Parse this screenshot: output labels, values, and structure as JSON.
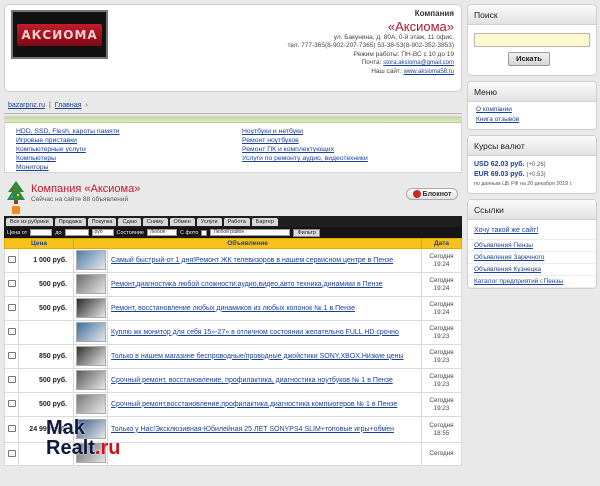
{
  "header": {
    "logo_text": "АКСИОМА",
    "company_label": "Компания",
    "company_name": "«Аксиома»",
    "address": "ул. Бакунина, д. 80А, 0-й этаж, 11 офис.",
    "phone": "тел. 777-365(8-902-207-7365) 53-38-53(8-902-352-3853)",
    "hours": "Режим работы: ПН-ВС с 10 до 19",
    "email_label": "Почта:",
    "email": "stora.aksioma@gmail.com",
    "site_label": "Наш сайт:",
    "site": "www.aksioma58.ru"
  },
  "breadcrumb": {
    "site": "bazarpnz.ru",
    "sep": "|",
    "home": "Главная",
    "arrow": "›"
  },
  "categories": {
    "left": [
      "HDD, SSD, Flesh, кароты памяти",
      "Игровые приставки",
      "Компьютерные услуги",
      "Компьютеры",
      "Мониторы"
    ],
    "right": [
      "Ноутбуки и нетбуки",
      "Ремонт ноутбуков",
      "Ремонт ПК и комплектующих",
      "Услуги по ремонту аудио, видеотехники"
    ]
  },
  "banner": {
    "title": "Компания «Аксиома»",
    "subtitle": "Сейчас на сайте 88 объявлений",
    "notebook_button": "Блокнот"
  },
  "tabs": [
    "Все из рубрики",
    "Продажа",
    "Покупка",
    "Сдаю",
    "Сниму",
    "Обмен",
    "Услуги",
    "Работа",
    "Бартер"
  ],
  "filters": {
    "price_from": "Цена от",
    "price_to": "до",
    "currency": "руб",
    "condition_label": "Состояние",
    "condition_value": "Любое",
    "photo_label": "С фото",
    "district_value": "Любой район",
    "filter_button": "Фильтр"
  },
  "table": {
    "columns": [
      "Цена",
      "Объявление",
      "Дата"
    ],
    "rows": [
      {
        "price": "1 000 руб.",
        "title": "Самый быстрый-от 1 дня!Ремонт ЖК телевизоров в нашем сервисном центре в Пензе",
        "date": "Сегодня",
        "time": "19:24",
        "thumb_color": "#4f7db0"
      },
      {
        "price": "500 руб.",
        "title": "Ремонт,диагностика любой сложности:аудио,видео,авто техника,динамики в Пензе",
        "date": "Сегодня",
        "time": "19:24",
        "thumb_color": "#6b6b6b"
      },
      {
        "price": "500 руб.",
        "title": "Ремонт, восстановление любых динамиков из любых колонок № 1 в Пензе",
        "date": "Сегодня",
        "time": "19:24",
        "thumb_color": "#2a2a2a"
      },
      {
        "price": "",
        "title": "Куплю жк монитор для себя 15»-27» в отличном состоянии желательно FULL HD срочно",
        "date": "Сегодня",
        "time": "19:23",
        "thumb_color": "#3b6f9e"
      },
      {
        "price": "850 руб.",
        "title": "Только в нашем магазине беспроводные/проводные джойстики SONY,XBOX.Низкие цены",
        "date": "Сегодня",
        "time": "19:23",
        "thumb_color": "#333333"
      },
      {
        "price": "500 руб.",
        "title": "Срочный ремонт, восстановление, профилактика, диагностика ноутбуков № 1 в Пензе",
        "date": "Сегодня",
        "time": "19:23",
        "thumb_color": "#5a5a5a"
      },
      {
        "price": "500 руб.",
        "title": "Срочный ремонт,восстановление,профилактика,диагностика компьютеров № 1 в Пензе",
        "date": "Сегодня",
        "time": "19:23",
        "thumb_color": "#7a7a7a"
      },
      {
        "price": "24 999 руб.",
        "title": "Только у Нас!Эксклюзивная-Юбилейная 25 ЛЕТ SONYPS4 SLIM+топовые игры+обмен",
        "date": "Сегодня",
        "time": "18:55",
        "thumb_color": "#3a5e8c"
      },
      {
        "price": "",
        "title": "",
        "date": "Сегодня",
        "time": "",
        "thumb_color": "#666666"
      }
    ]
  },
  "sidebar": {
    "search_title": "Поиск",
    "search_button": "Искать",
    "menu_title": "Меню",
    "menu_items": [
      "О компании",
      "Книга отзывов"
    ],
    "currency_title": "Курсы валют",
    "currencies": [
      {
        "code": "USD",
        "value": "62.03 руб.",
        "change": "(+0.26)"
      },
      {
        "code": "EUR",
        "value": "69.03 руб.",
        "change": "(+0.53)"
      }
    ],
    "currency_note": "по данным ЦБ РФ на 20 декабря 2019 г.",
    "links_title": "Ссылки",
    "links": [
      "Хочу такой же сайт!",
      "Объявления Пензы",
      "Объявления Заречного",
      "Объявления Кузнецка",
      "Каталог предприятий г.Пензы"
    ]
  },
  "watermark": {
    "part1": "Mak",
    "part2": "Realt",
    "part3": ".ru"
  }
}
